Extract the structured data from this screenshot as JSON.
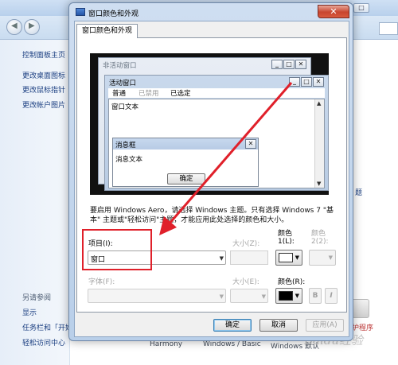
{
  "background_window": {
    "left_nav": [
      "控制面板主页",
      "更改桌面图标",
      "更改鼠标指针",
      "更改帐户图片"
    ],
    "see_also_label": "另请参阅",
    "see_also": [
      "显示",
      "任务栏和「开始」菜单",
      "轻松访问中心"
    ],
    "right_link_fragment": "题",
    "bottom_labels": [
      "Harmony",
      "Windows / Basic",
      "Windows 默认"
    ],
    "bottom_right_fragment": "护程序",
    "watermark": "Baidu经验"
  },
  "dialog": {
    "title": "窗口颜色和外观",
    "close_label": "✕",
    "tab": "窗口颜色和外观",
    "preview": {
      "inactive_title": "非活动窗口",
      "active_title": "活动窗口",
      "menu_items": [
        "普通",
        "已禁用",
        "已选定"
      ],
      "window_text": "窗口文本",
      "msgbox_title": "消息框",
      "msgbox_text": "消息文本",
      "ok_label": "确定",
      "btn_min": "_",
      "btn_max": "□",
      "btn_close": "✕"
    },
    "info_text": "要启用 Windows Aero，请选择 Windows 主题。只有选择 Windows 7 \"基本\" 主题或\"轻松访问\"主题，才能应用此处选择的颜色和大小。",
    "item_label": "项目(I):",
    "item_value": "窗口",
    "size_label": "大小(Z):",
    "color1_label_top": "颜色",
    "color1_label": "1(L):",
    "color2_label_top": "颜色",
    "color2_label": "2(2):",
    "font_label": "字体(F):",
    "font_size_label": "大小(E):",
    "font_color_label": "颜色(R):",
    "bold_label": "B",
    "italic_label": "I",
    "ok_button": "确定",
    "cancel_button": "取消",
    "apply_button": "应用(A)",
    "colors": {
      "color1": "#ffffff",
      "font_color": "#000000",
      "highlight": "#e0202a"
    }
  }
}
